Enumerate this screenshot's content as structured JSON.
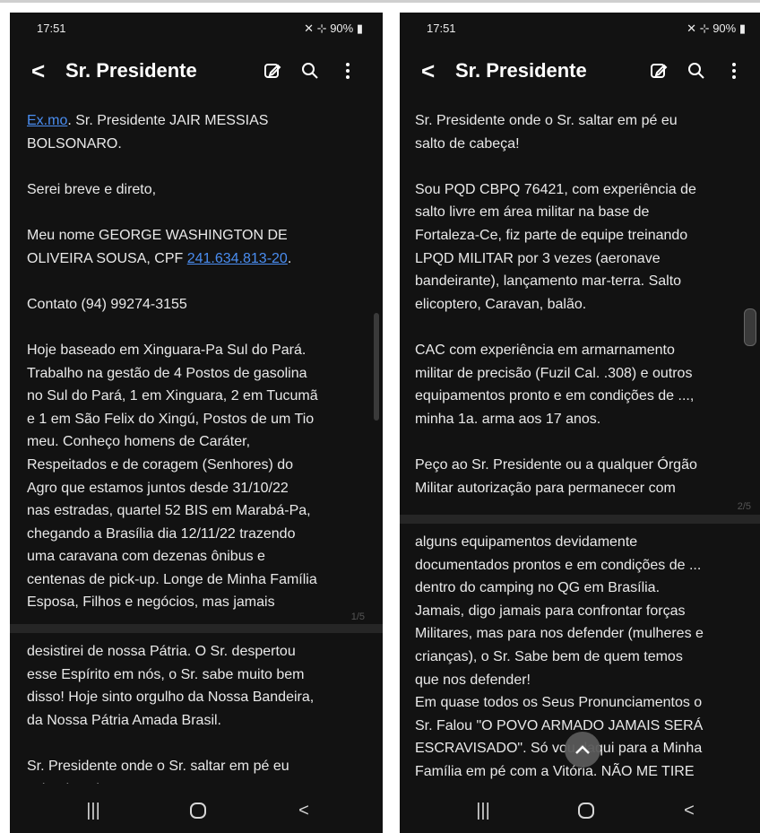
{
  "status_bar": {
    "time": "17:51",
    "battery": "90%"
  },
  "app_bar": {
    "title": "Sr. Presidente"
  },
  "left": {
    "page_indicator": "1/5",
    "block1": [
      {
        "link": "Ex.mo",
        "text": ". Sr. Presidente JAIR MESSIAS\nBOLSONARO."
      },
      {
        "text": "Serei breve e direto,"
      },
      {
        "pre": "Meu nome GEORGE WASHINGTON DE\nOLIVEIRA SOUSA, CPF ",
        "link": "241.634.813-20",
        "post": "."
      },
      {
        "text": "Contato (94) 99274-3155"
      },
      {
        "text": "Hoje baseado em Xinguara-Pa Sul do Pará.\nTrabalho na gestão de 4 Postos de gasolina\nno Sul do Pará, 1 em Xinguara, 2 em Tucumã\ne 1 em São Felix do Xingú, Postos de um Tio\nmeu. Conheço homens de Caráter,\nRespeitados e de coragem (Senhores) do\nAgro que estamos juntos desde 31/10/22\nnas estradas, quartel 52 BIS em Marabá-Pa,\nchegando a Brasília dia 12/11/22 trazendo\numa caravana com dezenas ônibus e\ncentenas de pick-up. Longe de Minha Família\nEsposa, Filhos e negócios, mas jamais"
      }
    ],
    "block2": [
      {
        "text": "desistirei de nossa Pátria. O Sr. despertou\nesse Espírito em nós, o Sr. sabe muito bem\ndisso! Hoje sinto orgulho da Nossa Bandeira,\nda Nossa Pátria Amada Brasil."
      },
      {
        "text": "Sr. Presidente onde o Sr. saltar em pé eu\nsalto de cabeça!"
      }
    ]
  },
  "right": {
    "page_indicator": "2/5",
    "block1": [
      {
        "text": "Sr. Presidente onde o Sr. saltar em pé eu\nsalto de cabeça!"
      },
      {
        "text": "Sou PQD CBPQ 76421, com experiência de\nsalto livre em área militar na base de\nFortaleza-Ce, fiz parte de equipe treinando\nLPQD MILITAR por 3 vezes (aeronave\nbandeirante), lançamento mar-terra. Salto\nelicoptero, Caravan, balão."
      },
      {
        "text": "CAC com experiência em armarnamento\nmilitar de precisão (Fuzil Cal. .308) e outros\nequipamentos pronto e em condições de ...,\nminha 1a. arma aos 17 anos."
      },
      {
        "text": "Peço ao Sr. Presidente ou a qualquer Órgão\nMilitar autorização  para permanecer com"
      }
    ],
    "block2": [
      {
        "text": "alguns equipamentos devidamente\ndocumentados prontos e em condições de ...\ndentro do camping no QG em Brasília.\nJamais, digo jamais para confrontar forças\nMilitares, mas para nos defender (mulheres e\ncrianças), o Sr. Sabe bem de quem temos\nque nos defender!\nEm quase todos os Seus Pronunciamentos o\nSr. Falou \"O POVO ARMADO JAMAIS SERÁ\nESCRAVISADO\". Só vou daqui para a Minha\nFamília em pé com a Vitória. NÃO ME TIRE\nESSA HONRA SR.!"
      }
    ]
  },
  "icons": {
    "back": "back-arrow-icon",
    "edit": "edit-icon",
    "search": "search-icon",
    "more": "more-vert-icon",
    "scroll_top": "chevron-up-icon",
    "nav_recents": "recents-icon",
    "nav_home": "home-icon",
    "nav_back": "nav-back-icon"
  },
  "colors": {
    "background": "#121212",
    "text": "#e9e9e9",
    "link": "#4a8df0"
  }
}
